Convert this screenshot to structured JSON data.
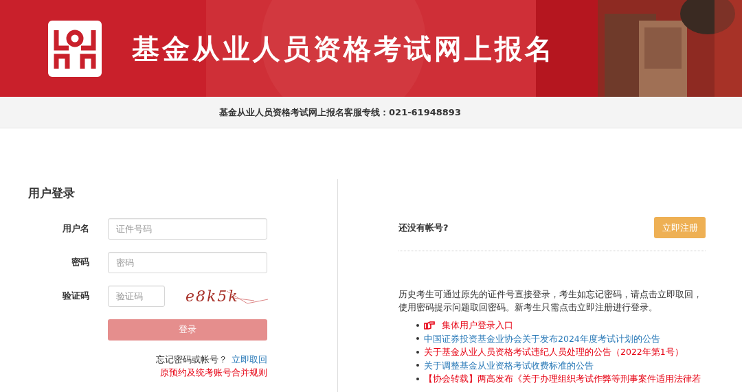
{
  "header": {
    "title": "基金从业人员资格考试网上报名",
    "hotline": "基金从业人员资格考试网上报名客服专线：021-61948893"
  },
  "login": {
    "title": "用户登录",
    "fields": [
      {
        "label": "用户名",
        "placeholder": "证件号码",
        "kind": "text"
      },
      {
        "label": "密码",
        "placeholder": "密码",
        "kind": "password"
      },
      {
        "label": "验证码",
        "placeholder": "验证码",
        "kind": "captcha"
      }
    ],
    "captcha": "e8k5k",
    "submit": {
      "label": "登录",
      "disabled": true
    },
    "forgot": {
      "text": "忘记密码或帐号？",
      "link": "立即取回"
    },
    "merge_rule": "原预约及统考账号合并规则"
  },
  "register": {
    "question": "还没有帐号?",
    "button": "立即注册"
  },
  "notice": "历史考生可通过原先的证件号直接登录，考生如忘记密码，请点击立即取回，使用密码提示问题取回密码。新考生只需点击立即注册进行登录。",
  "links": [
    {
      "text": "集体用户登录入口",
      "color": "#e60012",
      "kind": "pointer"
    },
    {
      "text": "中国证券投资基金业协会关于发布2024年度考试计划的公告",
      "color": "#2a7ab8",
      "kind": "plain"
    },
    {
      "text": "关于基金从业人员资格考试违纪人员处理的公告（2022年第1号）",
      "color": "#e60012",
      "kind": "plain"
    },
    {
      "text": "关于调整基金从业资格考试收费标准的公告",
      "color": "#2a7ab8",
      "kind": "plain"
    },
    {
      "text": "【协会转载】两高发布《关于办理组织考试作弊等刑事案件适用法律若",
      "color": "#e60012",
      "kind": "plain"
    }
  ]
}
